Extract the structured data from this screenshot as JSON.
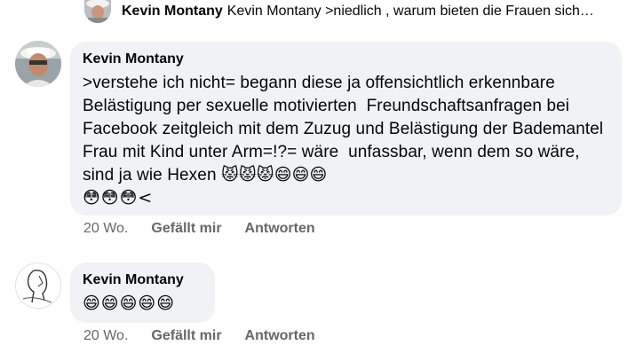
{
  "preview": {
    "author": "Kevin Montany",
    "text": "Kevin Montany >niedlich , warum bieten die Frauen sich…"
  },
  "comments": [
    {
      "author": "Kevin Montany",
      "text": ">verstehe ich nicht= begann diese ja offensichtlich erkennbare Belästigung per sexuelle motivierten  Freundschaftsanfragen bei Facebook zeitgleich mit dem Zuzug und Belästigung der Bademantel Frau mit Kind unter Arm=!?= wäre  unfassbar, wenn dem so wäre, sind ja wie Hexen 😾😾😾😄😄😄",
      "text_tail": "😳😳😳<",
      "time": "20 Wo.",
      "like": "Gefällt mir",
      "reply": "Antworten"
    },
    {
      "author": "Kevin Montany",
      "text": "😄😄😄😄😄",
      "time": "20 Wo.",
      "like": "Gefällt mir",
      "reply": "Antworten"
    }
  ]
}
